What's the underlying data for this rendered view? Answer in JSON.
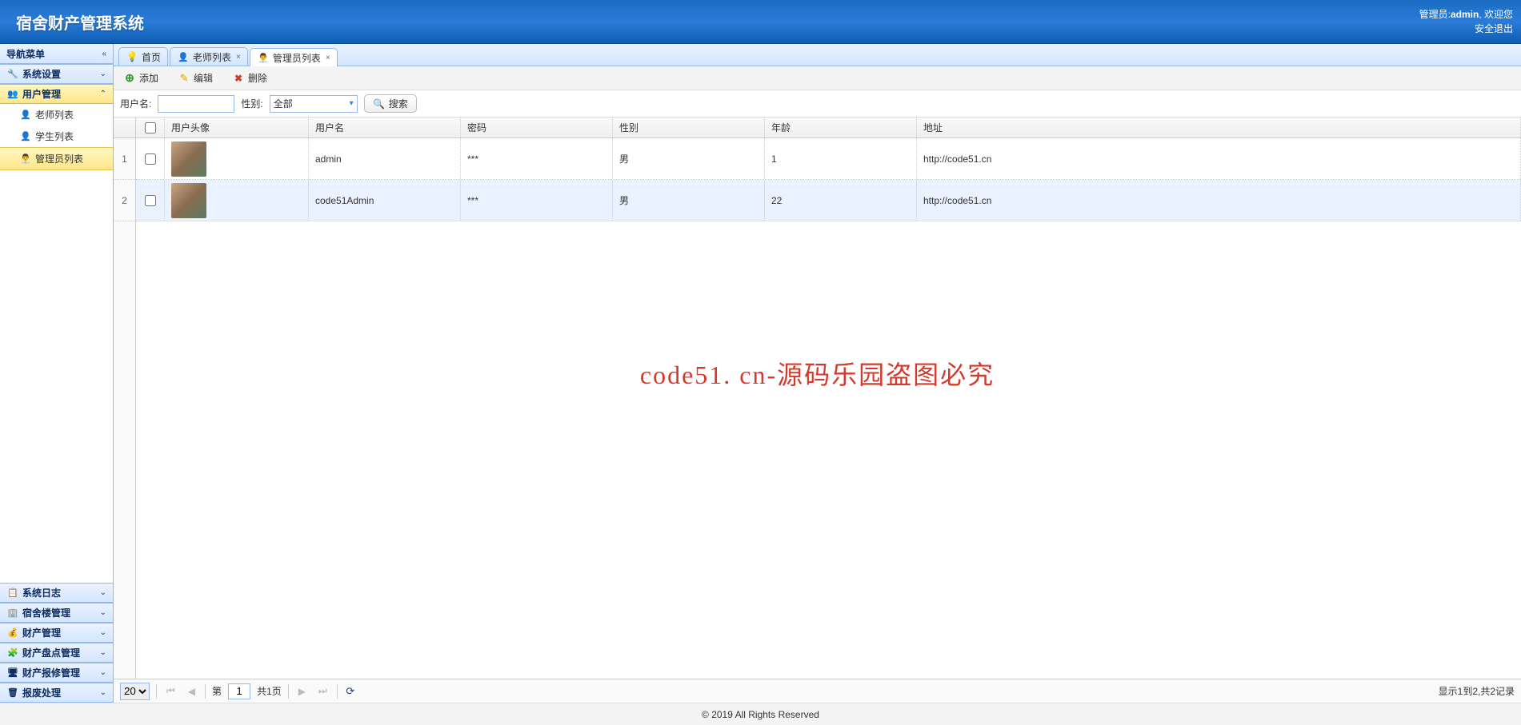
{
  "header": {
    "title": "宿舍财产管理系统",
    "admin_label": "管理员:",
    "admin_name": "admin",
    "welcome": ",   欢迎您",
    "logout": "安全退出"
  },
  "sidebar": {
    "nav_title": "导航菜单",
    "panels": [
      {
        "label": "系统设置",
        "icon": "ic-wrench",
        "expanded": false
      },
      {
        "label": "用户管理",
        "icon": "ic-users",
        "expanded": true,
        "selected": true,
        "items": [
          {
            "label": "老师列表",
            "icon": "ic-user",
            "active": false
          },
          {
            "label": "学生列表",
            "icon": "ic-user",
            "active": false
          },
          {
            "label": "管理员列表",
            "icon": "ic-admin",
            "active": true
          }
        ]
      },
      {
        "label": "系统日志",
        "icon": "ic-log",
        "expanded": false
      },
      {
        "label": "宿舍楼管理",
        "icon": "ic-build",
        "expanded": false
      },
      {
        "label": "财产管理",
        "icon": "ic-money",
        "expanded": false
      },
      {
        "label": "财产盘点管理",
        "icon": "ic-check",
        "expanded": false
      },
      {
        "label": "财产报修管理",
        "icon": "ic-repair",
        "expanded": false
      },
      {
        "label": "报废处理",
        "icon": "ic-trash",
        "expanded": false
      }
    ]
  },
  "tabs": [
    {
      "label": "首页",
      "icon": "ic-bulb",
      "closable": false,
      "active": false
    },
    {
      "label": "老师列表",
      "icon": "ic-user",
      "closable": true,
      "active": false
    },
    {
      "label": "管理员列表",
      "icon": "ic-admin",
      "closable": true,
      "active": true
    }
  ],
  "toolbar": {
    "add": "添加",
    "edit": "编辑",
    "delete": "删除"
  },
  "search": {
    "username_label": "用户名:",
    "username_value": "",
    "gender_label": "性别:",
    "gender_value": "全部",
    "search_btn": "搜索"
  },
  "grid": {
    "columns": {
      "avatar": "用户头像",
      "username": "用户名",
      "password": "密码",
      "gender": "性别",
      "age": "年龄",
      "address": "地址"
    },
    "rows": [
      {
        "num": "1",
        "username": "admin",
        "password": "***",
        "gender": "男",
        "age": "1",
        "address": "http://code51.cn"
      },
      {
        "num": "2",
        "username": "code51Admin",
        "password": "***",
        "gender": "男",
        "age": "22",
        "address": "http://code51.cn"
      }
    ]
  },
  "pager": {
    "page_size": "20",
    "page_prefix": "第",
    "page_value": "1",
    "page_total": "共1页",
    "info": "显示1到2,共2记录"
  },
  "footer": "© 2019 All Rights Reserved",
  "watermark": "code51. cn-源码乐园盗图必究"
}
